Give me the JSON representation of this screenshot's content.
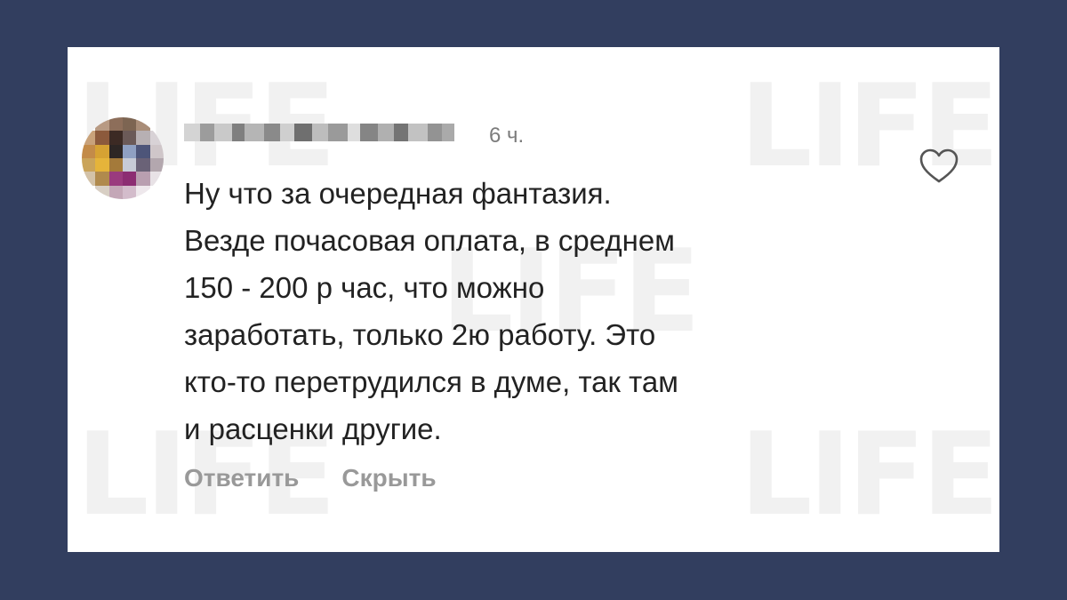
{
  "watermark": {
    "text": "LIFE"
  },
  "comment": {
    "avatar": {
      "icon": "user-avatar-pixelated"
    },
    "username": {
      "obscured": true
    },
    "time": "6 ч.",
    "text": "Ну что за очередная фантазия.\nВезде почасовая оплата, в среднем\n150 - 200 р час, что можно\nзаработать, только 2ю работу. Это\nкто-то перетрудился в думе, так там\nи расценки другие.",
    "like_icon": "heart-icon",
    "actions": {
      "reply_label": "Ответить",
      "hide_label": "Скрыть"
    }
  },
  "colors": {
    "background": "#323e5f",
    "card": "#ffffff",
    "text": "#222222",
    "muted": "#999999"
  }
}
